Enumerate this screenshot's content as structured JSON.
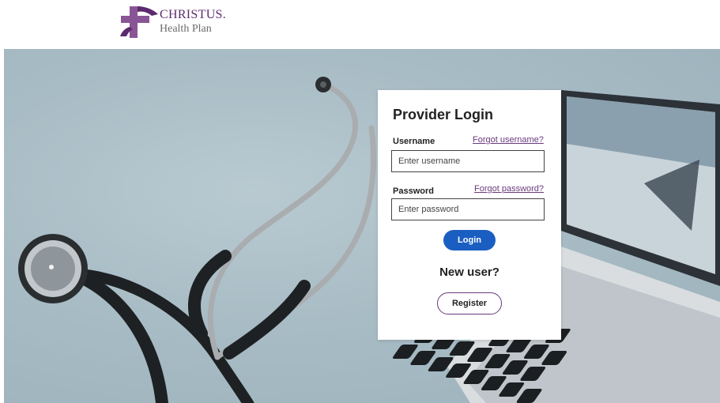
{
  "brand": {
    "name": "CHRISTUS.",
    "subtitle": "Health Plan",
    "colors": {
      "primary": "#5c2a6e",
      "secondary": "#8a5596"
    }
  },
  "hero": {
    "image": "stethoscope-and-laptop-photo"
  },
  "login": {
    "title": "Provider Login",
    "username_label": "Username",
    "forgot_username": "Forgot username?",
    "username_placeholder": "Enter username",
    "username_value": "",
    "password_label": "Password",
    "forgot_password": "Forgot password?",
    "password_placeholder": "Enter password",
    "password_value": "",
    "login_button": "Login",
    "new_user_text": "New user?",
    "register_button": "Register",
    "colors": {
      "login_button": "#1a5ec2",
      "link": "#6a3a7e",
      "register_border": "#6a3a7e"
    }
  }
}
